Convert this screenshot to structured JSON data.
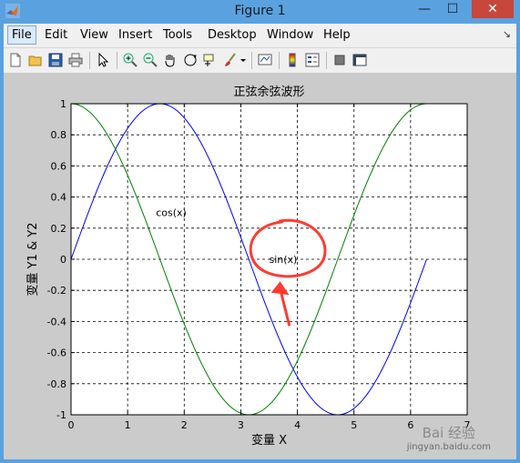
{
  "window": {
    "title": "Figure 1",
    "controls": {
      "minimize": "—",
      "maximize": "☐",
      "close": "✕"
    }
  },
  "menubar": {
    "items": [
      {
        "label": "File",
        "active": true
      },
      {
        "label": "Edit"
      },
      {
        "label": "View"
      },
      {
        "label": "Insert"
      },
      {
        "label": "Tools"
      },
      {
        "label": "Desktop"
      },
      {
        "label": "Window"
      },
      {
        "label": "Help"
      }
    ],
    "dock_arrow": "↘"
  },
  "toolbar": {
    "buttons": [
      "new-figure-icon",
      "open-file-icon",
      "save-icon",
      "print-icon",
      "pointer-icon",
      "zoom-in-icon",
      "zoom-out-icon",
      "pan-hand-icon",
      "rotate-3d-icon",
      "data-cursor-icon",
      "brush-icon",
      "dropdown-arrow-icon",
      "link-plot-icon",
      "colorbar-icon",
      "legend-icon",
      "hide-plot-tools-icon",
      "show-plot-tools-icon"
    ]
  },
  "chart_data": {
    "type": "line",
    "title": "正弦余弦波形",
    "xlabel": "变量 X",
    "ylabel": "变量 Y1 & Y2",
    "xlim": [
      0,
      7
    ],
    "ylim": [
      -1,
      1
    ],
    "xticks": [
      "0",
      "1",
      "2",
      "3",
      "4",
      "5",
      "6",
      "7"
    ],
    "yticks": [
      "1",
      "0.8",
      "0.6",
      "0.4",
      "0.2",
      "0",
      "-0.2",
      "-0.4",
      "-0.6",
      "-0.8",
      "-1"
    ],
    "grid": true,
    "x_range": [
      0,
      6.2832
    ],
    "series": [
      {
        "function": "sin",
        "color": "#0000ff"
      },
      {
        "function": "cos",
        "color": "#008000"
      }
    ],
    "annotations": [
      {
        "text": "cos(x)",
        "x": 1.5,
        "y": 0.3
      },
      {
        "text": "sin(x)",
        "x": 3.5,
        "y": 0.0
      }
    ],
    "markup": {
      "color": "#ff3b30"
    }
  },
  "watermark": {
    "brand": "Bai 经验",
    "url": "jingyan.baidu.com"
  }
}
